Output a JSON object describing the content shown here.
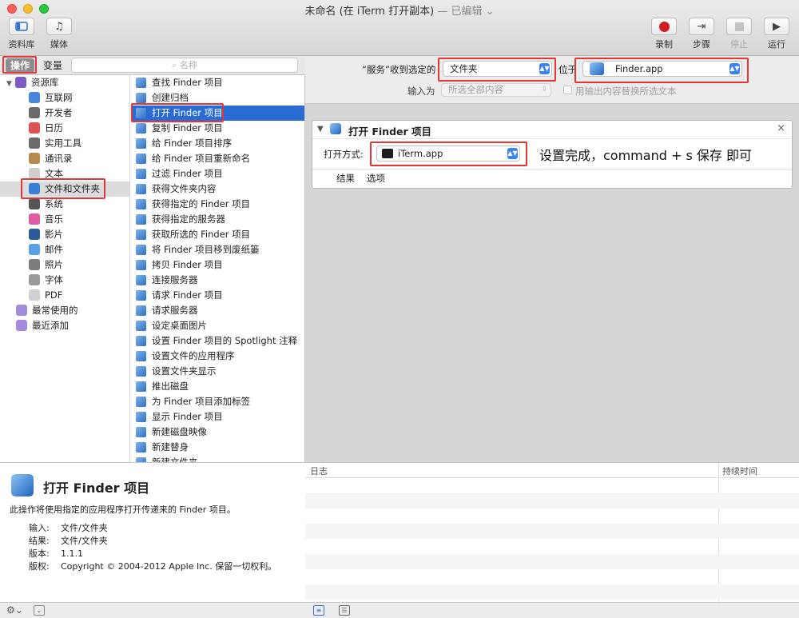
{
  "window": {
    "title": "未命名 (在 iTerm 打开副本)",
    "subtitle": "— 已编辑"
  },
  "toolbar": {
    "left": [
      {
        "label": "资料库",
        "icon": "sidebar-icon"
      },
      {
        "label": "媒体",
        "icon": "music-icon"
      }
    ],
    "right": [
      {
        "label": "录制",
        "icon": "record-icon"
      },
      {
        "label": "步骤",
        "icon": "step-icon"
      },
      {
        "label": "停止",
        "icon": "stop-icon"
      },
      {
        "label": "运行",
        "icon": "play-icon"
      }
    ]
  },
  "tabs": {
    "actions": "操作",
    "variables": "变量"
  },
  "search": {
    "placeholder": "名称"
  },
  "library": [
    {
      "label": "资源库",
      "icon": "library-icon",
      "color": "#7a5cc2"
    },
    {
      "label": "互联网",
      "icon": "globe-icon",
      "color": "#4a86d9"
    },
    {
      "label": "开发者",
      "icon": "tools-icon",
      "color": "#6a6a6a"
    },
    {
      "label": "日历",
      "icon": "calendar-icon",
      "color": "#e05252"
    },
    {
      "label": "实用工具",
      "icon": "wrench-icon",
      "color": "#6a6a6a"
    },
    {
      "label": "通讯录",
      "icon": "contacts-icon",
      "color": "#b58a4b"
    },
    {
      "label": "文本",
      "icon": "text-icon",
      "color": "#cfcfcf"
    },
    {
      "label": "文件和文件夹",
      "icon": "finder-icon",
      "color": "#3a7fd6"
    },
    {
      "label": "系统",
      "icon": "gear-icon",
      "color": "#555555"
    },
    {
      "label": "音乐",
      "icon": "music-icon",
      "color": "#e05aa4"
    },
    {
      "label": "影片",
      "icon": "film-icon",
      "color": "#2c5b9a"
    },
    {
      "label": "邮件",
      "icon": "mail-icon",
      "color": "#5aa0e6"
    },
    {
      "label": "照片",
      "icon": "photo-icon",
      "color": "#7c7c7c"
    },
    {
      "label": "字体",
      "icon": "font-icon",
      "color": "#9a9a9a"
    },
    {
      "label": "PDF",
      "icon": "pdf-icon",
      "color": "#d0d0d0"
    },
    {
      "label": "最常使用的",
      "icon": "folder-icon",
      "color": "#a58be0"
    },
    {
      "label": "最近添加",
      "icon": "folder-icon",
      "color": "#a58be0"
    }
  ],
  "actions": [
    "查找 Finder 项目",
    "创建归档",
    "打开 Finder 项目",
    "复制 Finder 项目",
    "给 Finder 项目排序",
    "给 Finder 项目重新命名",
    "过滤 Finder 项目",
    "获得文件夹内容",
    "获得指定的 Finder 项目",
    "获得指定的服务器",
    "获取所选的 Finder 项目",
    "将 Finder 项目移到废纸篓",
    "拷贝 Finder 项目",
    "连接服务器",
    "请求 Finder 项目",
    "请求服务器",
    "设定桌面图片",
    "设置 Finder 项目的 Spotlight 注释",
    "设置文件的应用程序",
    "设置文件夹显示",
    "推出磁盘",
    "为 Finder 项目添加标签",
    "显示 Finder 项目",
    "新建磁盘映像",
    "新建替身",
    "新建文件夹"
  ],
  "description": {
    "title": "打开 Finder 项目",
    "text": "此操作将使用指定的应用程序打开传递来的 Finder 项目。",
    "fields": [
      {
        "key": "输入:",
        "value": "文件/文件夹"
      },
      {
        "key": "结果:",
        "value": "文件/文件夹"
      },
      {
        "key": "版本:",
        "value": "1.1.1"
      },
      {
        "key": "版权:",
        "value": "Copyright © 2004-2012 Apple Inc. 保留一切权利。"
      }
    ]
  },
  "config": {
    "service_label": "“服务”收到选定的",
    "service_value": "文件夹",
    "location_label": "位于",
    "location_value": "Finder.app",
    "input_label": "输入为",
    "input_value": "所选全部内容",
    "replace_label": "用输出内容替换所选文本"
  },
  "card": {
    "title": "打开 Finder 项目",
    "open_with_label": "打开方式:",
    "app": "iTerm.app",
    "tabs": [
      "结果",
      "选项"
    ],
    "note": "设置完成，command + s 保存 即可"
  },
  "log": {
    "col1": "日志",
    "col2": "持续时间"
  },
  "colors": {
    "selection": "#2b6bd6",
    "highlight": "#e53535",
    "record": "#d11d1d"
  }
}
